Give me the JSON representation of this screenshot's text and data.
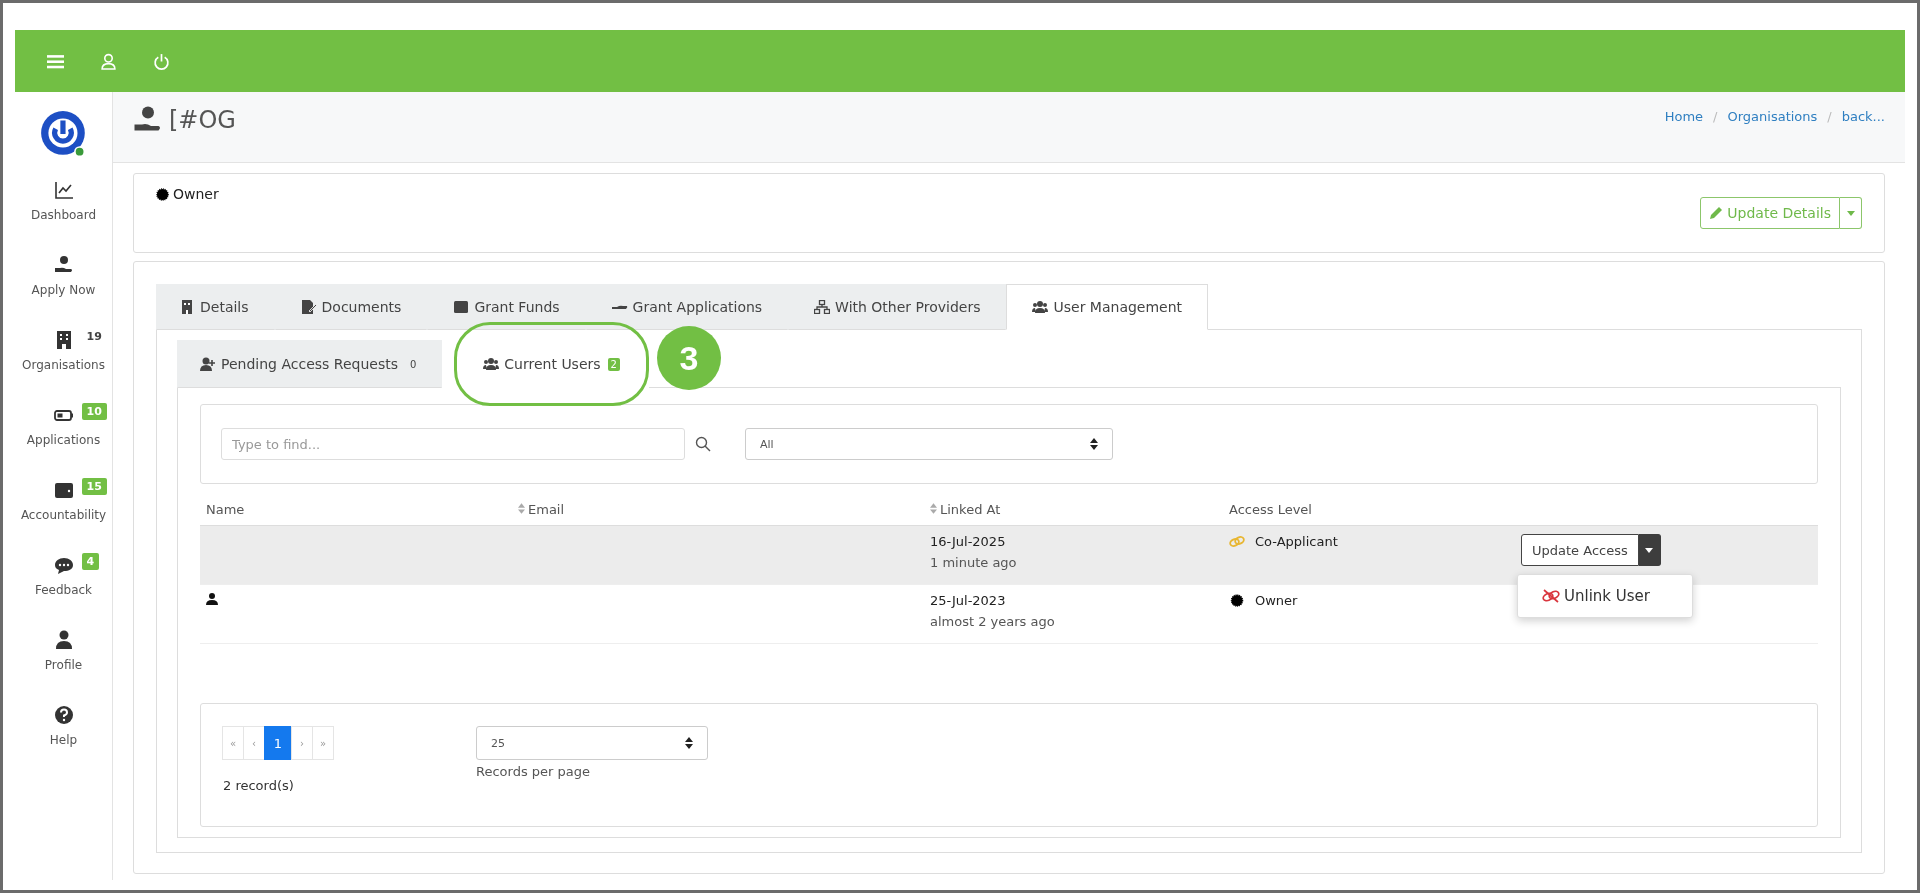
{
  "header": {
    "title": "[#OG"
  },
  "breadcrumb_separator": "/",
  "breadcrumbs": [
    {
      "label": "Home"
    },
    {
      "label": "Organisations"
    },
    {
      "label": "back..."
    }
  ],
  "sidebar": {
    "items": [
      {
        "label": "Dashboard"
      },
      {
        "label": "Apply Now"
      },
      {
        "label": "Organisations",
        "badge": {
          "text": "19",
          "kind": "plain"
        }
      },
      {
        "label": "Applications",
        "badge": {
          "text": "10",
          "kind": "green"
        }
      },
      {
        "label": "Accountability",
        "badge": {
          "text": "15",
          "kind": "green"
        }
      },
      {
        "label": "Feedback",
        "badge": {
          "text": "4",
          "kind": "green"
        }
      },
      {
        "label": "Profile"
      },
      {
        "label": "Help"
      }
    ]
  },
  "role": {
    "label": "Owner"
  },
  "update_button": {
    "label": "Update Details"
  },
  "tabs": [
    {
      "label": "Details",
      "selected": false
    },
    {
      "label": "Documents",
      "selected": false
    },
    {
      "label": "Grant Funds",
      "selected": false
    },
    {
      "label": "Grant Applications",
      "selected": false
    },
    {
      "label": "With Other Providers",
      "selected": false
    },
    {
      "label": "User Management",
      "selected": true
    }
  ],
  "subtabs": [
    {
      "label": "Pending Access Requests",
      "count": "0",
      "selected": false
    },
    {
      "label": "Current Users",
      "count": "2",
      "selected": true
    }
  ],
  "annotation": {
    "number": "3"
  },
  "search": {
    "placeholder": "Type to find..."
  },
  "filter": {
    "value": "All"
  },
  "table": {
    "columns": [
      {
        "label": "Name",
        "sortable": false
      },
      {
        "label": "Email",
        "sortable": true
      },
      {
        "label": "Linked At",
        "sortable": true
      },
      {
        "label": "Access Level",
        "sortable": false
      }
    ],
    "rows": [
      {
        "highlighted": true,
        "user_icon": false,
        "linked_date": "16-Jul-2025",
        "linked_ago": "1 minute ago",
        "access": {
          "label": "Co-Applicant",
          "kind": "co-applicant"
        },
        "action": {
          "label": "Update Access",
          "menu_open": true,
          "menu": [
            {
              "label": "Unlink User"
            }
          ]
        }
      },
      {
        "highlighted": false,
        "user_icon": true,
        "linked_date": "25-Jul-2023",
        "linked_ago": "almost 2 years ago",
        "access": {
          "label": "Owner",
          "kind": "owner"
        }
      }
    ]
  },
  "pagination": {
    "pages": [
      {
        "label": "«",
        "selected": false
      },
      {
        "label": "‹",
        "selected": false
      },
      {
        "label": "1",
        "selected": true
      },
      {
        "label": "›",
        "selected": false
      },
      {
        "label": "»",
        "selected": false
      }
    ]
  },
  "per_page": {
    "value": "25",
    "label": "Records per page"
  },
  "records": "2 record(s)"
}
